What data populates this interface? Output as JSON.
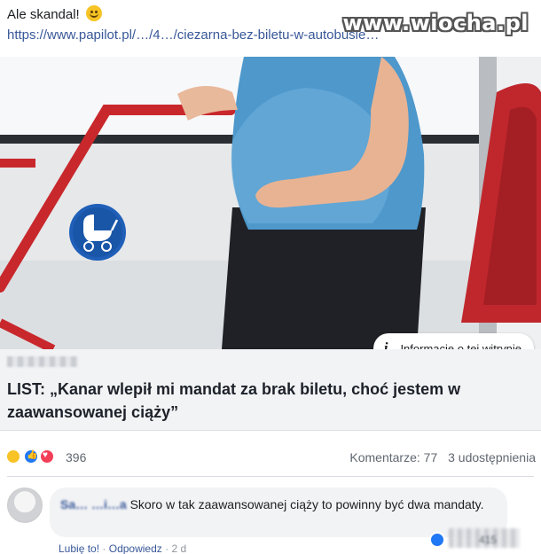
{
  "post": {
    "text": "Ale skandal!",
    "emoji": "smile-emoji",
    "link": "https://www.papilot.pl/…/4…/ciezarna-bez-biletu-w-autobusie…"
  },
  "watermark": "www.wiocha.pl",
  "card": {
    "info_label": "Informacje o tej witrynie",
    "info_icon": "i",
    "headline": "LIST: „Kanar wlepił mi mandat za brak biletu, choć jestem w zaawansowanej ciąży”"
  },
  "reactions": {
    "icons": [
      "haha-icon",
      "like-icon",
      "love-icon"
    ],
    "count": "396",
    "comments": "Komentarze: 77",
    "shares": "3 udostępnienia"
  },
  "comment": {
    "author": "Sa… …i…a",
    "text": "Skoro w tak zaawansowanej ciąży to powinny być dwa mandaty.",
    "like_action": "Lubię to!",
    "reply_action": "Odpowiedz",
    "time": "2 d",
    "reaction_count": "415"
  },
  "colors": {
    "link": "#385898",
    "card_bg": "#f2f3f5",
    "like": "#2078f4",
    "love": "#f33e58",
    "haha": "#f7c325"
  }
}
